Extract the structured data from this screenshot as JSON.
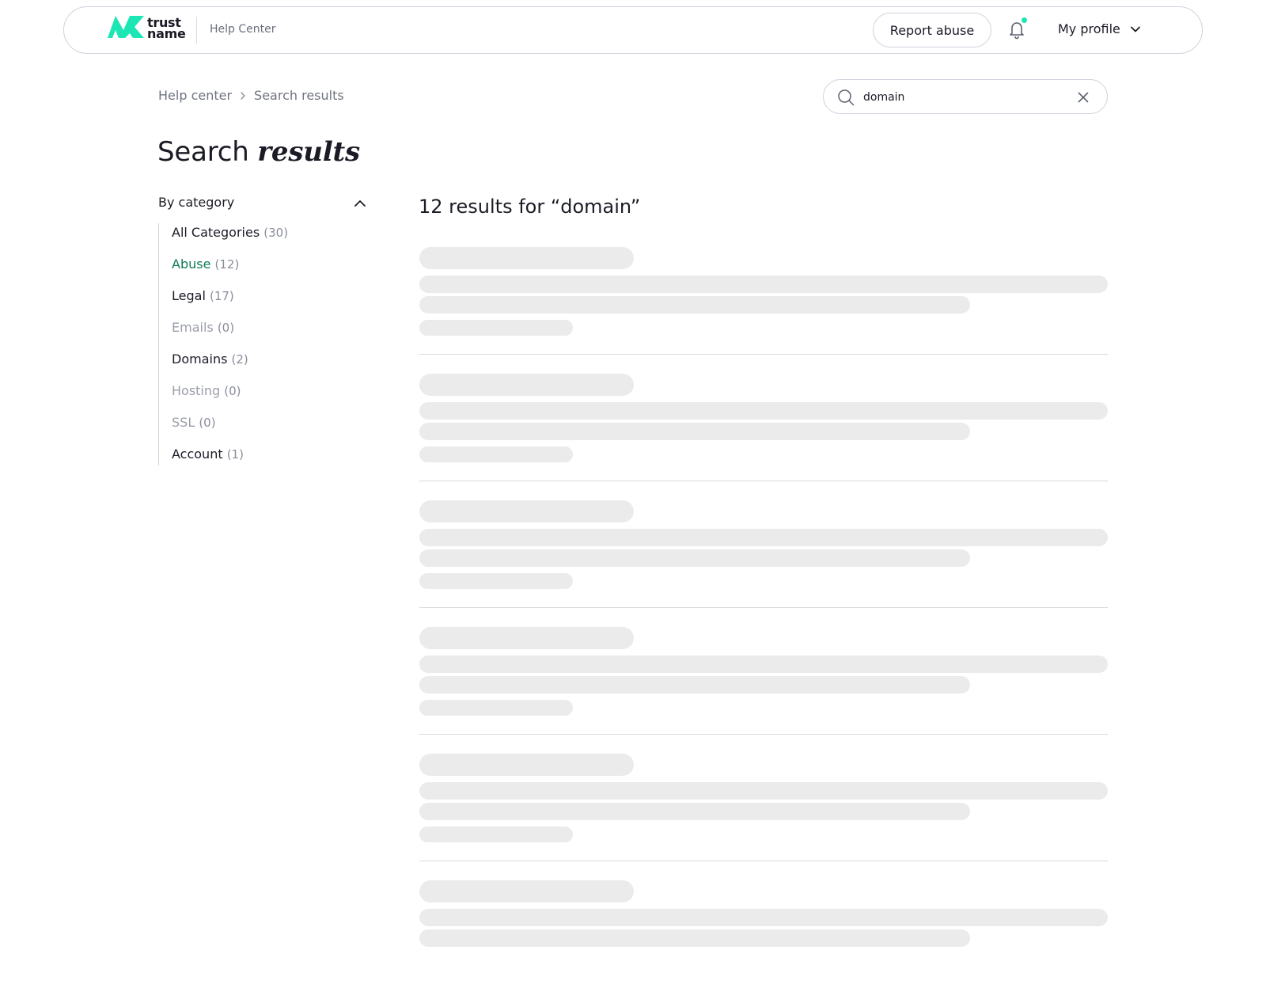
{
  "header": {
    "logo_line1": "trust",
    "logo_line2": "name",
    "section": "Help Center",
    "report_label": "Report abuse",
    "profile_label": "My profile",
    "accent_color": "#1ce6b4"
  },
  "breadcrumb": {
    "items": [
      "Help center",
      "Search results"
    ]
  },
  "search": {
    "value": "domain"
  },
  "title": {
    "plain": "Search",
    "emphasis": "results"
  },
  "filter": {
    "heading": "By category",
    "categories": [
      {
        "label": "All Categories",
        "count": "(30)",
        "state": "normal"
      },
      {
        "label": "Abuse",
        "count": "(12)",
        "state": "active"
      },
      {
        "label": "Legal",
        "count": "(17)",
        "state": "normal"
      },
      {
        "label": "Emails",
        "count": "(0)",
        "state": "disabled"
      },
      {
        "label": "Domains",
        "count": "(2)",
        "state": "normal"
      },
      {
        "label": "Hosting",
        "count": "(0)",
        "state": "disabled"
      },
      {
        "label": "SSL",
        "count": "(0)",
        "state": "disabled"
      },
      {
        "label": "Account",
        "count": "(1)",
        "state": "normal"
      }
    ]
  },
  "results": {
    "heading": "12 results for “domain”"
  }
}
